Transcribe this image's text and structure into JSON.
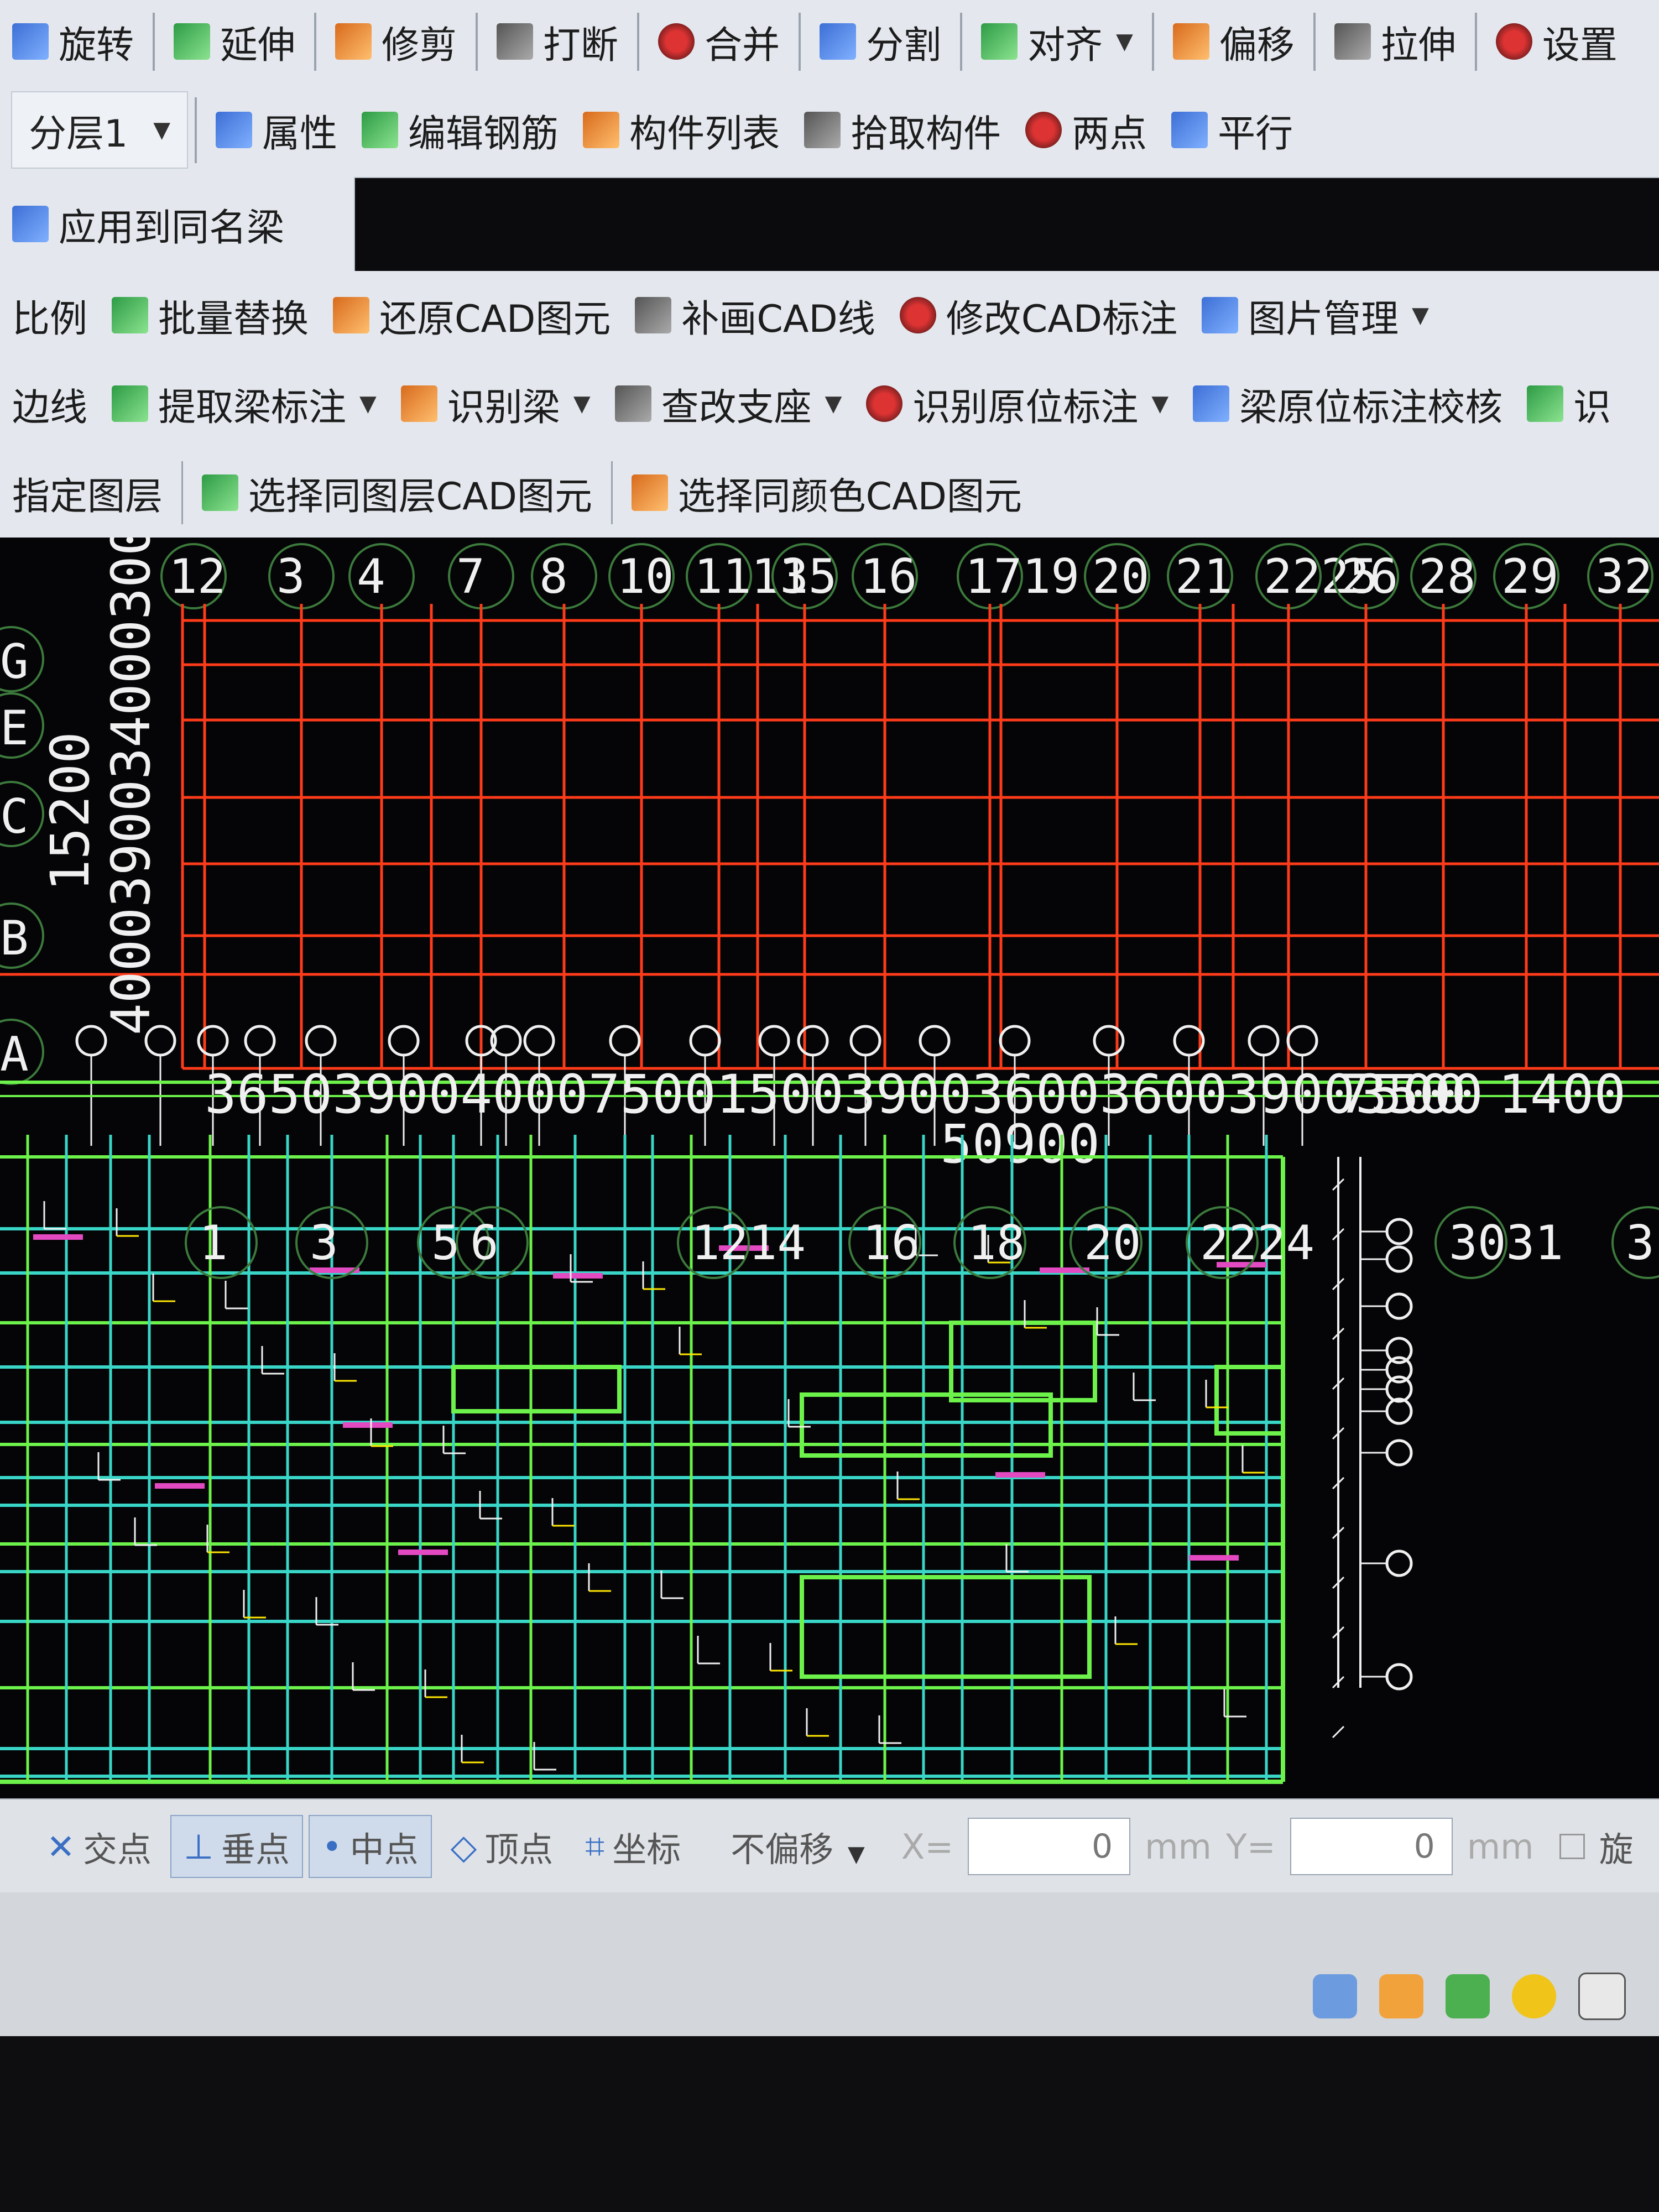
{
  "toolbar1": {
    "items": [
      {
        "label": "旋转",
        "icon": "rotate-icon"
      },
      {
        "label": "延伸",
        "icon": "extend-icon"
      },
      {
        "label": "修剪",
        "icon": "trim-icon"
      },
      {
        "label": "打断",
        "icon": "break-icon"
      },
      {
        "label": "合并",
        "icon": "merge-icon"
      },
      {
        "label": "分割",
        "icon": "split-icon"
      },
      {
        "label": "对齐",
        "icon": "align-icon",
        "dropdown": true
      },
      {
        "label": "偏移",
        "icon": "offset-icon"
      },
      {
        "label": "拉伸",
        "icon": "stretch-icon"
      },
      {
        "label": "设置",
        "icon": "settings-icon"
      }
    ]
  },
  "toolbar2": {
    "layer_select": "分层1",
    "items": [
      {
        "label": "属性",
        "icon": "properties-icon"
      },
      {
        "label": "编辑钢筋",
        "icon": "edit-rebar-icon"
      },
      {
        "label": "构件列表",
        "icon": "component-list-icon"
      },
      {
        "label": "拾取构件",
        "icon": "pick-component-icon"
      },
      {
        "label": "两点",
        "icon": "two-point-icon"
      },
      {
        "label": "平行",
        "icon": "parallel-icon"
      }
    ]
  },
  "toolbar3": {
    "items": [
      {
        "label": "应用到同名梁",
        "icon": "apply-same-beam-icon"
      }
    ]
  },
  "toolbar4": {
    "items": [
      {
        "label": "比例",
        "icon": ""
      },
      {
        "label": "批量替换",
        "icon": "batch-replace-icon"
      },
      {
        "label": "还原CAD图元",
        "icon": "restore-cad-icon"
      },
      {
        "label": "补画CAD线",
        "icon": "draw-cad-line-icon"
      },
      {
        "label": "修改CAD标注",
        "icon": "edit-cad-annotation-icon"
      },
      {
        "label": "图片管理",
        "icon": "image-manage-icon",
        "dropdown": true
      }
    ]
  },
  "toolbar5": {
    "items": [
      {
        "label": "边线",
        "icon": ""
      },
      {
        "label": "提取梁标注",
        "icon": "extract-beam-annotation-icon",
        "dropdown": true
      },
      {
        "label": "识别梁",
        "icon": "identify-beam-icon",
        "dropdown": true
      },
      {
        "label": "查改支座",
        "icon": "check-support-icon",
        "dropdown": true
      },
      {
        "label": "识别原位标注",
        "icon": "identify-inplace-annotation-icon",
        "dropdown": true
      },
      {
        "label": "梁原位标注校核",
        "icon": "beam-annotation-check-icon"
      },
      {
        "label": "识",
        "icon": "identify-icon"
      }
    ]
  },
  "toolbar6": {
    "items": [
      {
        "label": "指定图层",
        "icon": ""
      },
      {
        "label": "选择同图层CAD图元",
        "icon": "select-same-layer-icon"
      },
      {
        "label": "选择同颜色CAD图元",
        "icon": "select-same-color-icon"
      }
    ]
  },
  "cad": {
    "top_axes": [
      "12",
      "3",
      "4",
      "7",
      "8",
      "10",
      "1113",
      "15",
      "16",
      "1719",
      "20",
      "21",
      "2225",
      "26",
      "28",
      "29",
      "32"
    ],
    "left_axes": [
      "G",
      "E",
      "C",
      "B",
      "A"
    ],
    "left_dims": [
      "15200",
      "4000390034000300000"
    ],
    "dim_text": "3650390040007500150039003600360039003500",
    "dim_tail": "7500 1400 3900",
    "total_dim": "50900",
    "lower_axes": [
      "1",
      "3",
      "5",
      "6",
      "1214",
      "16",
      "18",
      "20",
      "2224",
      "3031",
      "3"
    ],
    "colors": {
      "red": "#ff3b1a",
      "cyan": "#39d6c8",
      "green": "#6cf24a",
      "magenta": "#e34ac2",
      "white": "#f0f0f0",
      "yellow": "#ffe600"
    }
  },
  "status": {
    "snaps": [
      {
        "label": "交点",
        "icon": "intersection-icon",
        "on": false
      },
      {
        "label": "垂点",
        "icon": "perpendicular-icon",
        "on": true
      },
      {
        "label": "中点",
        "icon": "midpoint-icon",
        "on": true
      },
      {
        "label": "顶点",
        "icon": "vertex-icon",
        "on": false
      },
      {
        "label": "坐标",
        "icon": "coordinate-icon",
        "on": false
      }
    ],
    "offset_mode": "不偏移",
    "x_label": "X=",
    "x_value": "0",
    "unit": "mm",
    "y_label": "Y=",
    "y_value": "0",
    "rotate_label": "旋"
  }
}
